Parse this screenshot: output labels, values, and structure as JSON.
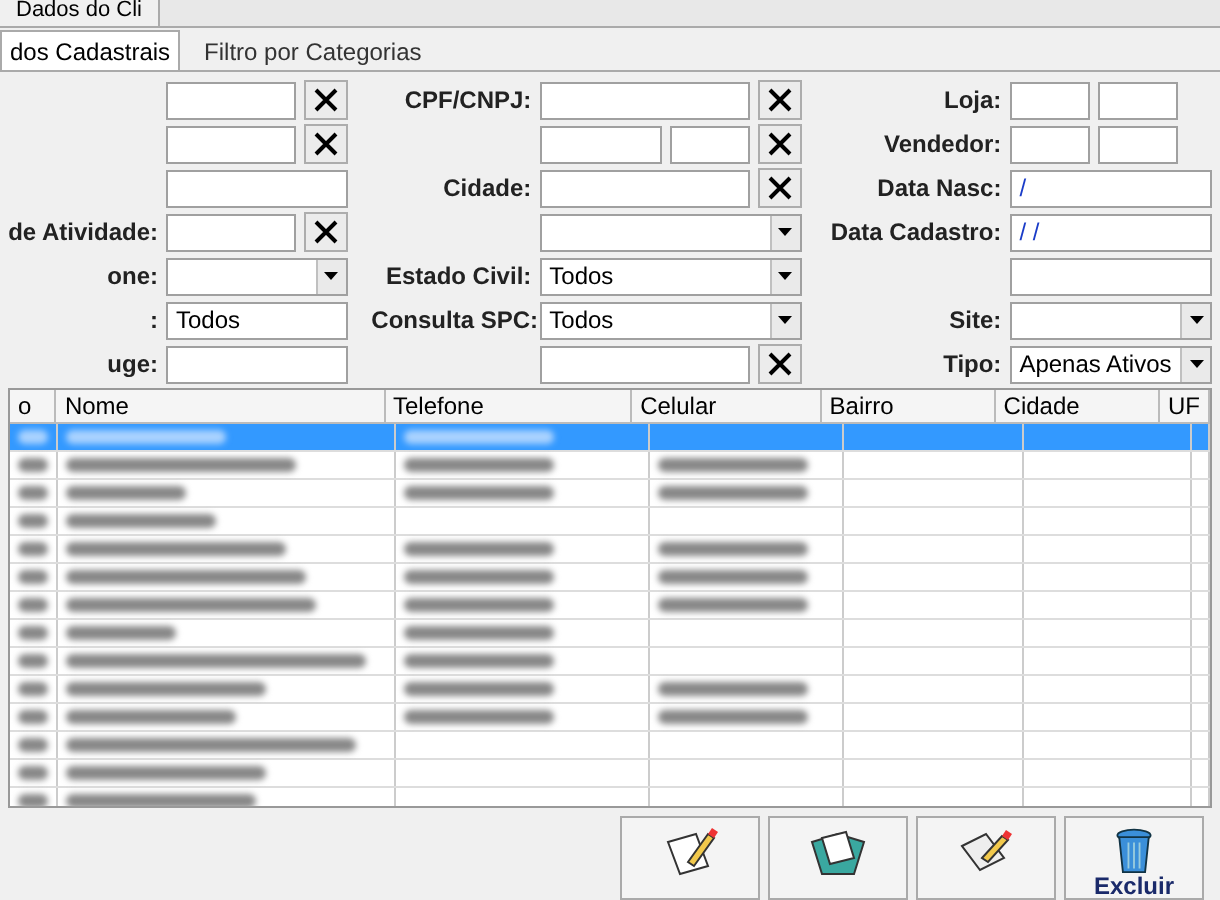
{
  "window_tabs": [
    {
      "label": "Dados do Cli",
      "selected": true
    }
  ],
  "tabs": [
    {
      "label": "dos Cadastrais",
      "selected": true
    },
    {
      "label": "Filtro por Categorias",
      "selected": false
    }
  ],
  "form": {
    "columns": [
      [
        {
          "fields": [
            {
              "kind": "text"
            }
          ],
          "clear": true
        },
        {
          "fields": [
            {
              "kind": "text"
            }
          ],
          "clear": true
        },
        {
          "fields": [
            {
              "kind": "text"
            }
          ],
          "clear": false
        },
        {
          "label": "de Atividade:",
          "fields": [
            {
              "kind": "text"
            }
          ],
          "clear": true
        },
        {
          "label": "one:",
          "fields": [
            {
              "kind": "combo"
            }
          ],
          "clear": false
        },
        {
          "label": ":",
          "fields": [
            {
              "kind": "text",
              "value": "Todos"
            }
          ],
          "clear": false
        },
        {
          "label": "uge:",
          "fields": [
            {
              "kind": "text"
            }
          ],
          "clear": false
        }
      ],
      [
        {
          "label": "CPF/CNPJ:",
          "fields": [
            {
              "kind": "text"
            }
          ],
          "clear": true
        },
        {
          "fields": [
            {
              "kind": "text"
            },
            {
              "kind": "small"
            }
          ],
          "clear": true
        },
        {
          "label": "Cidade:",
          "fields": [
            {
              "kind": "text"
            }
          ],
          "clear": true
        },
        {
          "fields": [
            {
              "kind": "combo"
            }
          ],
          "clear": false
        },
        {
          "label": "Estado Civil:",
          "fields": [
            {
              "kind": "combo",
              "value": "Todos"
            }
          ],
          "clear": false
        },
        {
          "label": "Consulta SPC:",
          "fields": [
            {
              "kind": "combo",
              "value": "Todos"
            }
          ],
          "clear": false
        },
        {
          "fields": [
            {
              "kind": "text"
            }
          ],
          "clear": true
        }
      ],
      [
        {
          "label": "Loja:",
          "fields": [
            {
              "kind": "small"
            },
            {
              "kind": "small"
            }
          ],
          "clear": false
        },
        {
          "label": "Vendedor:",
          "fields": [
            {
              "kind": "small"
            },
            {
              "kind": "small"
            }
          ],
          "clear": false
        },
        {
          "label": "Data Nasc:",
          "fields": [
            {
              "kind": "text",
              "value": "/"
            }
          ],
          "clear": false
        },
        {
          "label": "Data Cadastro:",
          "fields": [
            {
              "kind": "text",
              "value": "/ /"
            }
          ],
          "clear": false
        },
        {
          "fields": [
            {
              "kind": "text"
            }
          ],
          "clear": false
        },
        {
          "label": "Site:",
          "fields": [
            {
              "kind": "combo"
            }
          ],
          "clear": false
        },
        {
          "label": "Tipo:",
          "fields": [
            {
              "kind": "combo",
              "value": "Apenas Ativos"
            }
          ],
          "clear": false
        }
      ]
    ]
  },
  "table": {
    "columns": [
      "o",
      "Nome",
      "Telefone",
      "Celular",
      "Bairro",
      "Cidade",
      "UF"
    ],
    "rows": [
      {
        "selected": true
      },
      {
        "selected": false
      },
      {
        "selected": false
      },
      {
        "selected": false
      },
      {
        "selected": false
      },
      {
        "selected": false
      },
      {
        "selected": false
      },
      {
        "selected": false
      },
      {
        "selected": false
      },
      {
        "selected": false
      },
      {
        "selected": false
      },
      {
        "selected": false
      },
      {
        "selected": false
      },
      {
        "selected": false
      }
    ]
  },
  "toolbar": [
    {
      "kind": "edit"
    },
    {
      "kind": "folder"
    },
    {
      "kind": "edit-doc"
    },
    {
      "kind": "trash",
      "label": "Excluir"
    }
  ]
}
